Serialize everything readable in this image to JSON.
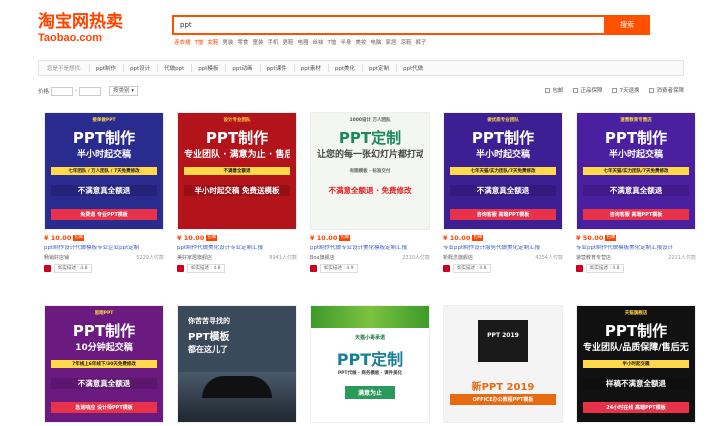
{
  "logo": {
    "main": "淘宝网热卖",
    "sub": "Taobao.com"
  },
  "search": {
    "value": "ppt",
    "button_label": "搜索"
  },
  "hotwords": [
    {
      "label": "连衣裙",
      "hot": true
    },
    {
      "label": "T恤",
      "hot": true
    },
    {
      "label": "女鞋",
      "hot": true
    },
    {
      "label": "男装",
      "hot": false
    },
    {
      "label": "零食",
      "hot": false
    },
    {
      "label": "童装",
      "hot": false
    },
    {
      "label": "手机",
      "hot": false
    },
    {
      "label": "男鞋",
      "hot": false
    },
    {
      "label": "电器",
      "hot": false
    },
    {
      "label": "丝袜",
      "hot": false
    },
    {
      "label": "T恤",
      "hot": false
    },
    {
      "label": "半身",
      "hot": false
    },
    {
      "label": "美妆",
      "hot": false
    },
    {
      "label": "电脑",
      "hot": false
    },
    {
      "label": "家居",
      "hot": false
    },
    {
      "label": "凉鞋",
      "hot": false
    },
    {
      "label": "裤子",
      "hot": false
    }
  ],
  "filter": {
    "label": "您是不是想找:",
    "items": [
      "ppt制作",
      "ppt设计",
      "代做ppt",
      "ppt模板",
      "ppt动画",
      "ppt课件",
      "ppt素材",
      "ppt美化",
      "ppt定制",
      "ppt代做"
    ]
  },
  "sort": {
    "price_label": "价格",
    "price_sep": "-",
    "dropdown_value": "按类别",
    "checks": [
      "包邮",
      "正品保障",
      "7天退换",
      "消费者保障"
    ]
  },
  "products": [
    {
      "price": "¥ 10.00",
      "tag": "包邮",
      "title": "ppt制作设计代做模板专业企业ppt定制",
      "shop": "畅销好店铺",
      "sold": "5229人付款",
      "rating": "如实描述 : 4.8",
      "thumb": {
        "bg": "#2a2b8f",
        "lines": [
          "接单做PPT",
          "PPT制作",
          "半小时起交稿",
          "七年团队 / 万人团队 / 7天免费修改",
          "不满意真全额退",
          "免费退   专业PPT模板"
        ]
      }
    },
    {
      "price": "¥ 10.00",
      "tag": "包邮",
      "title": "ppt制作代做美化设计专业定制汇报",
      "shop": "美好家居旗舰店",
      "sold": "8941人付款",
      "rating": "如实描述 : 4.8",
      "thumb": {
        "bg": "#b3131b",
        "lines": [
          "设计专业团队",
          "PPT制作",
          "专业团队 · 满意为止 · 售后保证",
          "不满意全额退",
          "半小时起交稿 免费送模板"
        ]
      }
    },
    {
      "price": "¥ 10.00",
      "tag": "包邮",
      "title": "ppt制作代做专业设计美化模板定制汇报",
      "shop": "Boa旗舰店",
      "sold": "2310人付款",
      "rating": "如实描述 : 4.9",
      "thumb": {
        "bg": "#f4f6f1",
        "lines": [
          "1000设计 万人团队",
          "PPT定制",
          "让您的每一张幻灯片都打动人心",
          "有图模板 · 标准交付",
          "不满意全额退 · 免费修改"
        ]
      }
    },
    {
      "price": "¥ 10.00",
      "tag": "包邮",
      "title": "专业ppt制作设计服务代做美化定制汇报",
      "shop": "新概念旗舰店",
      "sold": "4254人付款",
      "rating": "如实描述 : 4.8",
      "thumb": {
        "bg": "#3d1f94",
        "lines": [
          "做优质专业团队",
          "PPT制作",
          "半小时起交稿",
          "七年天猫/实力团队/7天免费修改",
          "不满意真全额退",
          "咨询客服   高端PPT模板"
        ]
      }
    },
    {
      "price": "¥ 50.00",
      "tag": "包邮",
      "title": "专业ppt制作代做模板美化定制汇报设计",
      "shop": "速营教育专营店",
      "sold": "2211人付款",
      "rating": "如实描述 : 4.8",
      "thumb": {
        "bg": "#4a1fa0",
        "lines": [
          "速营教育专营店",
          "PPT制作",
          "半小时起交稿",
          "七年天猫/实力团队/7天免费修改",
          "不满意真全额退",
          "咨询客服   高端PPT模板"
        ]
      }
    }
  ],
  "products_row2": [
    {
      "thumb": {
        "bg": "#6b1a80",
        "lines": [
          "思翔PPT",
          "PPT制作",
          "10分钟起交稿",
          "7年线上6年线下/30天免费修改",
          "不满意真全额退",
          "急速响应   设计师PPT模板"
        ]
      }
    },
    {
      "thumb": {
        "bg": "#3a4a5a",
        "lines": [
          "你苦苦寻找的",
          "PPT模板",
          "都在这儿了"
        ]
      }
    },
    {
      "thumb": {
        "bg": "#ffffff",
        "lines": [
          "天猫小哥承诺",
          "PPT定制",
          "PPT代做 · 商务模板 · 课件美化",
          "满意为止"
        ]
      }
    },
    {
      "thumb": {
        "bg": "#f4f4f4",
        "lines": [
          "PPT 2019",
          "新PPT 2019",
          "OFFICE办公教程PPT模板"
        ]
      }
    },
    {
      "thumb": {
        "bg": "#111111",
        "lines": [
          "天猫旗舰店",
          "PPT制作",
          "专业团队/品质保障/售后无忧",
          "半小时起交稿",
          "样稿不满意全额退",
          "24小时在线   高端PPT模板"
        ]
      }
    }
  ]
}
